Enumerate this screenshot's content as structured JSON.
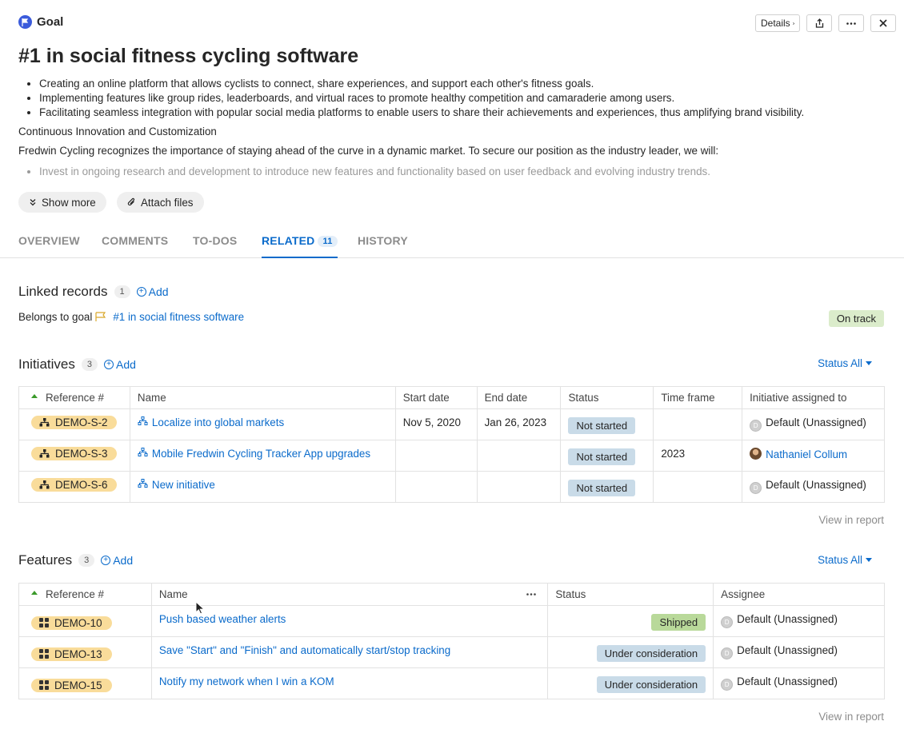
{
  "header": {
    "type_label": "Goal",
    "details_label": "Details",
    "title": "#1 in social fitness cycling software"
  },
  "description": {
    "bullets": [
      "Creating an online platform that allows cyclists to connect, share experiences, and support each other's fitness goals.",
      "Implementing features like group rides, leaderboards, and virtual races to promote healthy competition and camaraderie among users.",
      "Facilitating seamless integration with popular social media platforms to enable users to share their achievements and experiences, thus amplifying brand visibility."
    ],
    "heading": "Continuous Innovation and Customization",
    "paragraph": "Fredwin Cycling recognizes the importance of staying ahead of the curve in a dynamic market. To secure our position as the industry leader, we will:",
    "faded_bullet": "Invest in ongoing research and development to introduce new features and functionality based on user feedback and evolving industry trends."
  },
  "actions": {
    "show_more": "Show more",
    "attach_files": "Attach files"
  },
  "tabs": [
    {
      "label": "OVERVIEW"
    },
    {
      "label": "COMMENTS"
    },
    {
      "label": "TO-DOS"
    },
    {
      "label": "RELATED",
      "count": "11"
    },
    {
      "label": "HISTORY"
    }
  ],
  "linked_records": {
    "title": "Linked records",
    "count": "1",
    "add_label": "Add",
    "belongs_label": "Belongs to goal",
    "goal_link": "#1 in social fitness software",
    "status": "On track"
  },
  "initiatives": {
    "title": "Initiatives",
    "count": "3",
    "add_label": "Add",
    "status_filter": "Status All",
    "columns": [
      "Reference #",
      "Name",
      "Start date",
      "End date",
      "Status",
      "Time frame",
      "Initiative assigned to"
    ],
    "rows": [
      {
        "ref": "DEMO-S-2",
        "name": "Localize into global markets",
        "start": "Nov 5, 2020",
        "end": "Jan 26, 2023",
        "status": "Not started",
        "timeframe": "",
        "assignee": "Default (Unassigned)"
      },
      {
        "ref": "DEMO-S-3",
        "name": "Mobile Fredwin Cycling Tracker App upgrades",
        "start": "",
        "end": "",
        "status": "Not started",
        "timeframe": "2023",
        "assignee": "Nathaniel Collum"
      },
      {
        "ref": "DEMO-S-6",
        "name": "New initiative",
        "start": "",
        "end": "",
        "status": "Not started",
        "timeframe": "",
        "assignee": "Default (Unassigned)"
      }
    ],
    "view_report": "View in report"
  },
  "features": {
    "title": "Features",
    "count": "3",
    "add_label": "Add",
    "status_filter": "Status All",
    "columns": [
      "Reference #",
      "Name",
      "Status",
      "Assignee"
    ],
    "rows": [
      {
        "ref": "DEMO-10",
        "name": "Push based weather alerts",
        "status": "Shipped",
        "assignee": "Default (Unassigned)"
      },
      {
        "ref": "DEMO-13",
        "name": "Save \"Start\" and \"Finish\" and automatically start/stop tracking",
        "status": "Under consideration",
        "assignee": "Default (Unassigned)"
      },
      {
        "ref": "DEMO-15",
        "name": "Notify my network when I win a KOM",
        "status": "Under consideration",
        "assignee": "Default (Unassigned)"
      }
    ],
    "view_report": "View in report"
  },
  "colors": {
    "accent": "#0b6bcb",
    "ref_chip": "#f9dc9a",
    "on_track": "#dbeccb",
    "not_started": "#c9dbe8",
    "shipped": "#b9d99a"
  }
}
